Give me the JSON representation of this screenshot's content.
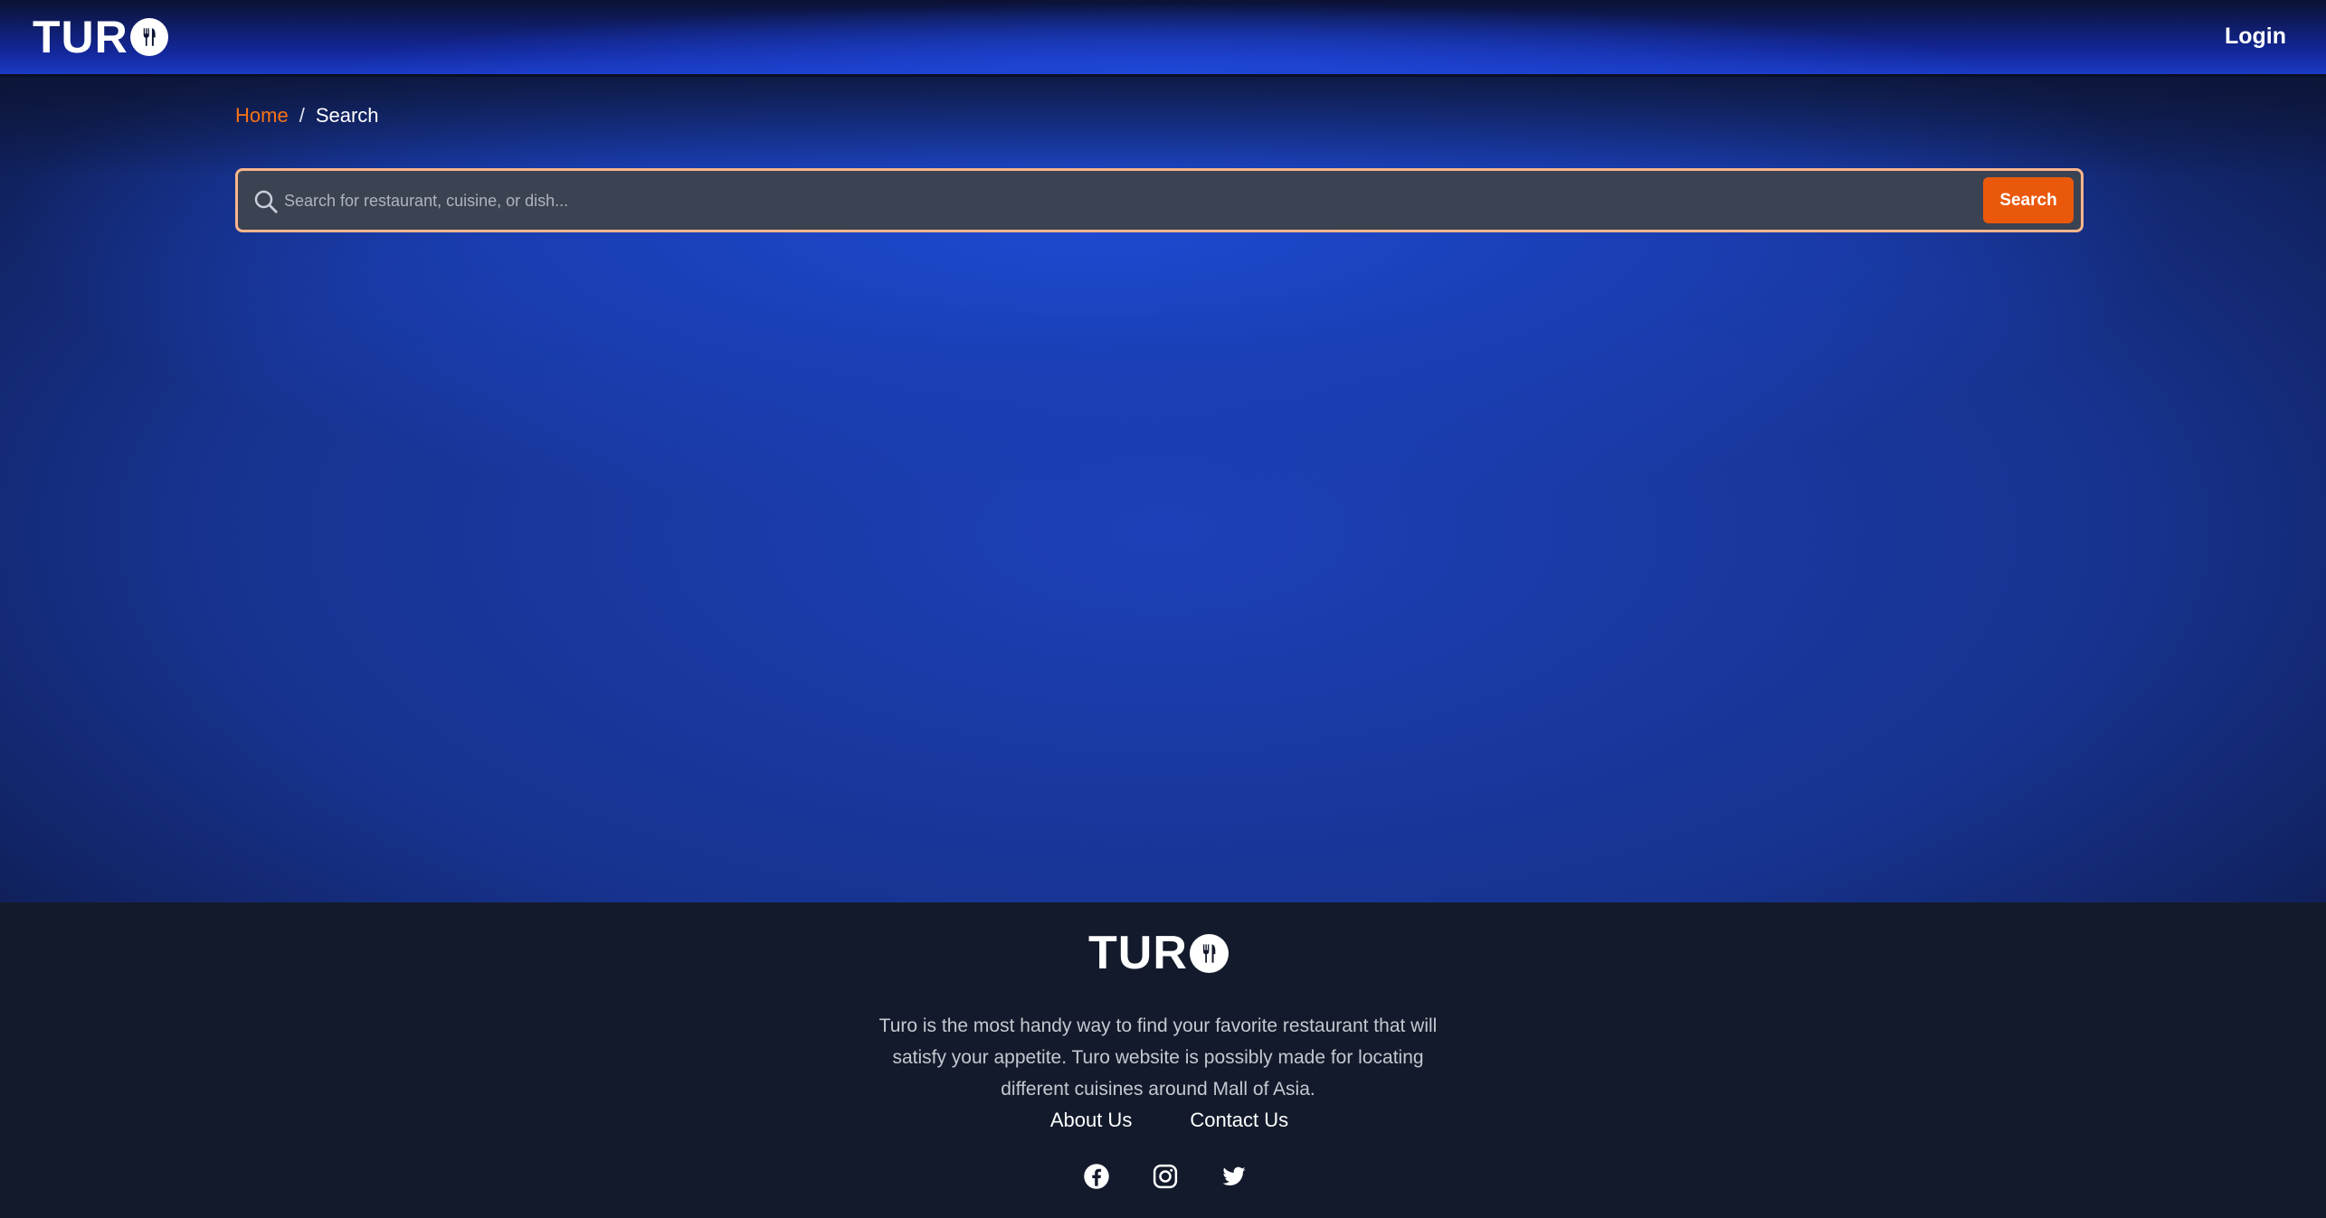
{
  "brand": {
    "name": "TURO",
    "logo_text": "TUR",
    "accent_color": "#ea580c",
    "link_color": "#f97316"
  },
  "header": {
    "login_label": "Login"
  },
  "breadcrumb": {
    "home": "Home",
    "separator": "/",
    "current": "Search"
  },
  "search": {
    "placeholder": "Search for restaurant, cuisine, or dish...",
    "value": "",
    "button_label": "Search",
    "icon": "search-icon"
  },
  "footer": {
    "logo_text": "TUR",
    "description": "Turo is the most handy way to find your favorite restaurant that will satisfy your appetite. Turo website is possibly made for locating different cuisines around Mall of Asia.",
    "links": [
      {
        "label": "About Us"
      },
      {
        "label": "Contact Us"
      }
    ],
    "socials": [
      {
        "icon": "facebook-icon"
      },
      {
        "icon": "instagram-icon"
      },
      {
        "icon": "twitter-icon"
      }
    ]
  }
}
